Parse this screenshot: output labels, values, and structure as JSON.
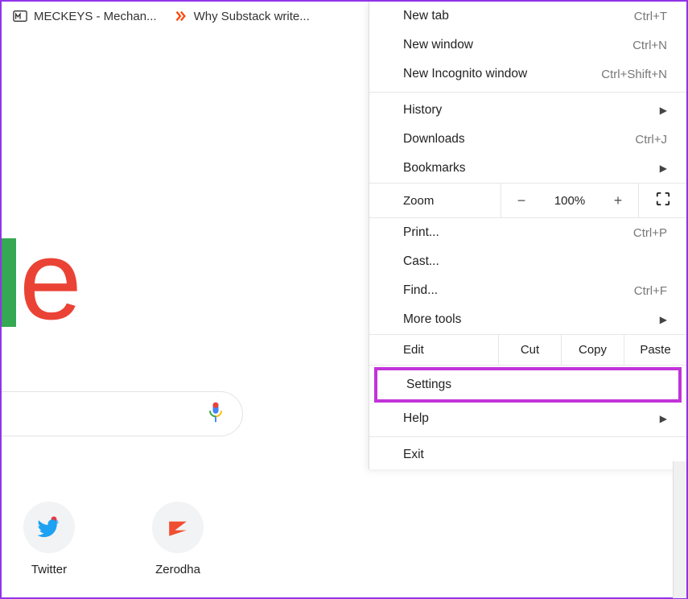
{
  "tabs": [
    {
      "title": "MECKEYS - Mechan..."
    },
    {
      "title": "Why Substack write..."
    }
  ],
  "logo_fragment": {
    "char": "e"
  },
  "shortcuts_row": [
    {
      "label": "Twitter"
    },
    {
      "label": "Zerodha"
    }
  ],
  "menu": {
    "new_tab": {
      "label": "New tab",
      "key": "Ctrl+T"
    },
    "new_window": {
      "label": "New window",
      "key": "Ctrl+N"
    },
    "incognito": {
      "label": "New Incognito window",
      "key": "Ctrl+Shift+N"
    },
    "history": {
      "label": "History"
    },
    "downloads": {
      "label": "Downloads",
      "key": "Ctrl+J"
    },
    "bookmarks": {
      "label": "Bookmarks"
    },
    "zoom": {
      "label": "Zoom",
      "minus": "−",
      "value": "100%",
      "plus": "+"
    },
    "print": {
      "label": "Print...",
      "key": "Ctrl+P"
    },
    "cast": {
      "label": "Cast..."
    },
    "find": {
      "label": "Find...",
      "key": "Ctrl+F"
    },
    "more_tools": {
      "label": "More tools"
    },
    "edit": {
      "label": "Edit",
      "cut": "Cut",
      "copy": "Copy",
      "paste": "Paste"
    },
    "settings": {
      "label": "Settings"
    },
    "help": {
      "label": "Help"
    },
    "exit": {
      "label": "Exit"
    }
  }
}
